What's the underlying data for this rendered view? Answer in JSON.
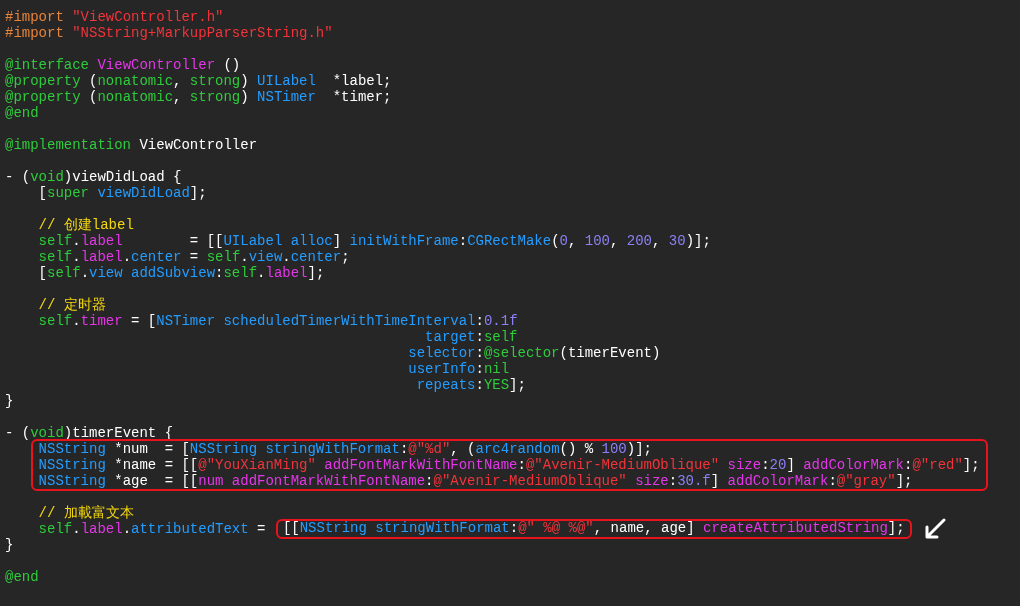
{
  "editor": {
    "lines": [
      {
        "tokens": [
          {
            "kind": "pp",
            "text": "#import "
          },
          {
            "kind": "str",
            "text": "\"ViewController.h\""
          }
        ]
      },
      {
        "tokens": [
          {
            "kind": "pp",
            "text": "#import "
          },
          {
            "kind": "str",
            "text": "\"NSString+MarkupParserString.h\""
          }
        ]
      },
      {
        "blank_before": true,
        "tokens": [
          {
            "kind": "kw",
            "text": "@interface "
          },
          {
            "kind": "cls",
            "text": "ViewController"
          },
          {
            "kind": "plain",
            "text": " ()"
          }
        ]
      },
      {
        "tokens": [
          {
            "kind": "kw",
            "text": "@property "
          },
          {
            "kind": "plain",
            "text": "("
          },
          {
            "kind": "kw",
            "text": "nonatomic"
          },
          {
            "kind": "plain",
            "text": ", "
          },
          {
            "kind": "kw",
            "text": "strong"
          },
          {
            "kind": "plain",
            "text": ") "
          },
          {
            "kind": "type",
            "text": "UILabel"
          },
          {
            "kind": "plain",
            "text": "  *label;"
          }
        ]
      },
      {
        "tokens": [
          {
            "kind": "kw",
            "text": "@property "
          },
          {
            "kind": "plain",
            "text": "("
          },
          {
            "kind": "kw",
            "text": "nonatomic"
          },
          {
            "kind": "plain",
            "text": ", "
          },
          {
            "kind": "kw",
            "text": "strong"
          },
          {
            "kind": "plain",
            "text": ") "
          },
          {
            "kind": "type",
            "text": "NSTimer"
          },
          {
            "kind": "plain",
            "text": "  *timer;"
          }
        ]
      },
      {
        "tokens": [
          {
            "kind": "kw",
            "text": "@end"
          }
        ]
      },
      {
        "blank_before": true,
        "tokens": [
          {
            "kind": "kw",
            "text": "@implementation "
          },
          {
            "kind": "plain",
            "text": "ViewController"
          }
        ]
      },
      {
        "blank_before": true,
        "tokens": [
          {
            "kind": "plain",
            "text": "- ("
          },
          {
            "kind": "kw",
            "text": "void"
          },
          {
            "kind": "plain",
            "text": ")viewDidLoad {"
          }
        ]
      },
      {
        "tokens": [
          {
            "kind": "plain",
            "text": "    ["
          },
          {
            "kind": "kw",
            "text": "super "
          },
          {
            "kind": "type",
            "text": "viewDidLoad"
          },
          {
            "kind": "plain",
            "text": "];"
          }
        ]
      },
      {
        "blank_before": true,
        "tokens": [
          {
            "kind": "cmt",
            "text": "    // 创建label"
          }
        ]
      },
      {
        "tokens": [
          {
            "kind": "kw",
            "text": "    self"
          },
          {
            "kind": "plain",
            "text": "."
          },
          {
            "kind": "cls",
            "text": "label"
          },
          {
            "kind": "plain",
            "text": "        = [["
          },
          {
            "kind": "type",
            "text": "UILabel alloc"
          },
          {
            "kind": "plain",
            "text": "] "
          },
          {
            "kind": "type",
            "text": "initWithFrame"
          },
          {
            "kind": "plain",
            "text": ":"
          },
          {
            "kind": "type",
            "text": "CGRectMake"
          },
          {
            "kind": "plain",
            "text": "("
          },
          {
            "kind": "num",
            "text": "0"
          },
          {
            "kind": "plain",
            "text": ", "
          },
          {
            "kind": "num",
            "text": "100"
          },
          {
            "kind": "plain",
            "text": ", "
          },
          {
            "kind": "num",
            "text": "200"
          },
          {
            "kind": "plain",
            "text": ", "
          },
          {
            "kind": "num",
            "text": "30"
          },
          {
            "kind": "plain",
            "text": ")];"
          }
        ]
      },
      {
        "tokens": [
          {
            "kind": "kw",
            "text": "    self"
          },
          {
            "kind": "plain",
            "text": "."
          },
          {
            "kind": "cls",
            "text": "label"
          },
          {
            "kind": "plain",
            "text": "."
          },
          {
            "kind": "type",
            "text": "center"
          },
          {
            "kind": "plain",
            "text": " = "
          },
          {
            "kind": "kw",
            "text": "self"
          },
          {
            "kind": "plain",
            "text": "."
          },
          {
            "kind": "type",
            "text": "view"
          },
          {
            "kind": "plain",
            "text": "."
          },
          {
            "kind": "type",
            "text": "center"
          },
          {
            "kind": "plain",
            "text": ";"
          }
        ]
      },
      {
        "tokens": [
          {
            "kind": "plain",
            "text": "    ["
          },
          {
            "kind": "kw",
            "text": "self"
          },
          {
            "kind": "plain",
            "text": "."
          },
          {
            "kind": "type",
            "text": "view addSubview"
          },
          {
            "kind": "plain",
            "text": ":"
          },
          {
            "kind": "kw",
            "text": "self"
          },
          {
            "kind": "plain",
            "text": "."
          },
          {
            "kind": "cls",
            "text": "label"
          },
          {
            "kind": "plain",
            "text": "];"
          }
        ]
      },
      {
        "blank_before": true,
        "tokens": [
          {
            "kind": "cmt",
            "text": "    // 定时器"
          }
        ]
      },
      {
        "tokens": [
          {
            "kind": "kw",
            "text": "    self"
          },
          {
            "kind": "plain",
            "text": "."
          },
          {
            "kind": "cls",
            "text": "timer"
          },
          {
            "kind": "plain",
            "text": " = ["
          },
          {
            "kind": "type",
            "text": "NSTimer scheduledTimerWithTimeInterval"
          },
          {
            "kind": "plain",
            "text": ":"
          },
          {
            "kind": "num",
            "text": "0.1f"
          }
        ]
      },
      {
        "tokens": [
          {
            "kind": "type",
            "text": "                                                  target"
          },
          {
            "kind": "plain",
            "text": ":"
          },
          {
            "kind": "kw",
            "text": "self"
          }
        ]
      },
      {
        "tokens": [
          {
            "kind": "type",
            "text": "                                                selector"
          },
          {
            "kind": "plain",
            "text": ":"
          },
          {
            "kind": "kw",
            "text": "@selector"
          },
          {
            "kind": "plain",
            "text": "(timerEvent)"
          }
        ]
      },
      {
        "tokens": [
          {
            "kind": "type",
            "text": "                                                userInfo"
          },
          {
            "kind": "plain",
            "text": ":"
          },
          {
            "kind": "kw",
            "text": "nil"
          }
        ]
      },
      {
        "tokens": [
          {
            "kind": "type",
            "text": "                                                 repeats"
          },
          {
            "kind": "plain",
            "text": ":"
          },
          {
            "kind": "kw",
            "text": "YES"
          },
          {
            "kind": "plain",
            "text": "];"
          }
        ]
      },
      {
        "tokens": [
          {
            "kind": "plain",
            "text": "}"
          }
        ]
      },
      {
        "blank_before": true,
        "tokens": [
          {
            "kind": "plain",
            "text": "- ("
          },
          {
            "kind": "kw",
            "text": "void"
          },
          {
            "kind": "plain",
            "text": ")timerEvent {"
          }
        ]
      },
      {
        "boxed": true,
        "tokens": [
          {
            "kind": "type",
            "text": "    NSString"
          },
          {
            "kind": "plain",
            "text": " *num  = ["
          },
          {
            "kind": "type",
            "text": "NSString stringWithFormat"
          },
          {
            "kind": "plain",
            "text": ":"
          },
          {
            "kind": "str",
            "text": "@\"%d\""
          },
          {
            "kind": "plain",
            "text": ", ("
          },
          {
            "kind": "type",
            "text": "arc4random"
          },
          {
            "kind": "plain",
            "text": "() % "
          },
          {
            "kind": "num",
            "text": "100"
          },
          {
            "kind": "plain",
            "text": ")];"
          }
        ]
      },
      {
        "boxed": true,
        "tokens": [
          {
            "kind": "type",
            "text": "    NSString"
          },
          {
            "kind": "plain",
            "text": " *name = [["
          },
          {
            "kind": "str",
            "text": "@\"YouXianMing\""
          },
          {
            "kind": "cls",
            "text": " addFontMarkWithFontName"
          },
          {
            "kind": "plain",
            "text": ":"
          },
          {
            "kind": "str",
            "text": "@\"Avenir-MediumOblique\""
          },
          {
            "kind": "cls",
            "text": " size"
          },
          {
            "kind": "plain",
            "text": ":"
          },
          {
            "kind": "num",
            "text": "20"
          },
          {
            "kind": "plain",
            "text": "] "
          },
          {
            "kind": "cls",
            "text": "addColorMark"
          },
          {
            "kind": "plain",
            "text": ":"
          },
          {
            "kind": "str",
            "text": "@\"red\""
          },
          {
            "kind": "plain",
            "text": "];"
          }
        ]
      },
      {
        "boxed": true,
        "tokens": [
          {
            "kind": "type",
            "text": "    NSString"
          },
          {
            "kind": "plain",
            "text": " *age  = [["
          },
          {
            "kind": "cls",
            "text": "num addFontMarkWithFontName"
          },
          {
            "kind": "plain",
            "text": ":"
          },
          {
            "kind": "str",
            "text": "@\"Avenir-MediumOblique\""
          },
          {
            "kind": "cls",
            "text": " size"
          },
          {
            "kind": "plain",
            "text": ":"
          },
          {
            "kind": "num",
            "text": "30.f"
          },
          {
            "kind": "plain",
            "text": "] "
          },
          {
            "kind": "cls",
            "text": "addColorMark"
          },
          {
            "kind": "plain",
            "text": ":"
          },
          {
            "kind": "str",
            "text": "@\"gray\""
          },
          {
            "kind": "plain",
            "text": "];"
          }
        ]
      },
      {
        "blank_before": true,
        "tokens": [
          {
            "kind": "cmt",
            "text": "    // 加載富文本"
          }
        ]
      },
      {
        "arrow": true,
        "tokens": [
          {
            "kind": "kw",
            "text": "    self"
          },
          {
            "kind": "plain",
            "text": "."
          },
          {
            "kind": "cls",
            "text": "label"
          },
          {
            "kind": "plain",
            "text": "."
          },
          {
            "kind": "type",
            "text": "attributedText"
          },
          {
            "kind": "plain",
            "text": " = "
          }
        ],
        "highlight": {
          "tokens": [
            {
              "kind": "plain",
              "text": "[["
            },
            {
              "kind": "type",
              "text": "NSString stringWithFormat"
            },
            {
              "kind": "plain",
              "text": ":"
            },
            {
              "kind": "str",
              "text": "@\" %@ %@\""
            },
            {
              "kind": "plain",
              "text": ", name, age] "
            },
            {
              "kind": "cls",
              "text": "createAttributedString"
            },
            {
              "kind": "plain",
              "text": "];"
            }
          ]
        }
      },
      {
        "tokens": [
          {
            "kind": "plain",
            "text": "}"
          }
        ]
      },
      {
        "blank_before": true,
        "tokens": [
          {
            "kind": "kw",
            "text": "@end"
          }
        ]
      }
    ]
  }
}
